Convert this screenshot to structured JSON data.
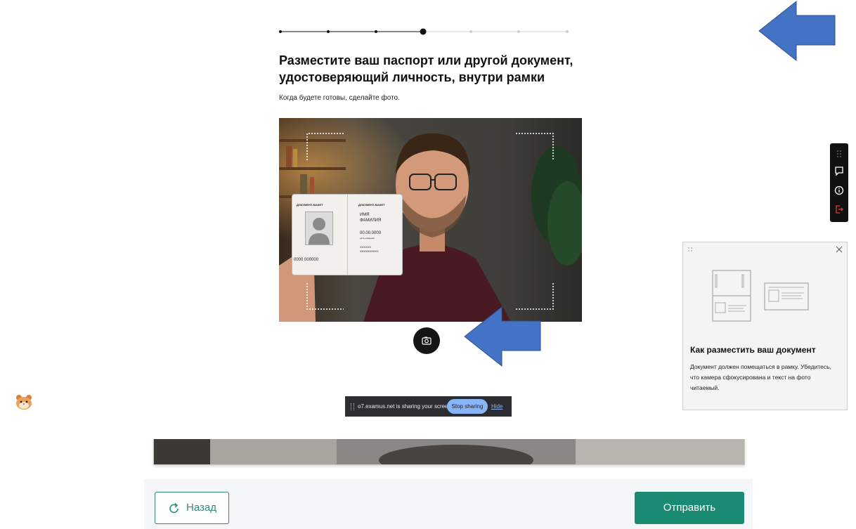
{
  "progress": {
    "total_steps": 7,
    "current_step": 4
  },
  "heading": "Разместите ваш паспорт или другой документ, удостоверяющий личность, внутри рамки",
  "subtext": "Когда будете готовы, сделайте фото.",
  "camera": {
    "card": {
      "left_header": "ДОКУМЕНТ-МАКЕТ",
      "right_header": "ДОКУМЕНТ-МАКЕТ",
      "name_line1": "ИМЯ",
      "name_line2": "ФАМИЛИЯ",
      "date": "00.00.0000",
      "date_caption": "дата рождения",
      "code1": "XXXXXX",
      "code2": "XXXXXXXXXX",
      "number": "0000 000000"
    }
  },
  "screen_share": {
    "message": "o7.examus.net is sharing your screen.",
    "stop_label": "Stop sharing",
    "hide_label": "Hide"
  },
  "tip": {
    "title": "Как разместить ваш документ",
    "text": "Документ должен помещаться в рамку. Убедитесь, что камера сфокусирована и текст на фото читаемый."
  },
  "footer": {
    "back_label": "Назад",
    "submit_label": "Отправить"
  },
  "colors": {
    "accent": "#1a8a73",
    "arrow": "#4472c4",
    "share_button": "#8ab4f8",
    "exit_icon": "#e53935"
  },
  "icons": {
    "capture": "camera-icon",
    "back": "refresh-icon",
    "toolbar": [
      "drag-handle-icon",
      "chat-icon",
      "info-icon",
      "exit-icon"
    ],
    "tip_close": "close-icon",
    "emoji": "hamster-face-icon"
  }
}
